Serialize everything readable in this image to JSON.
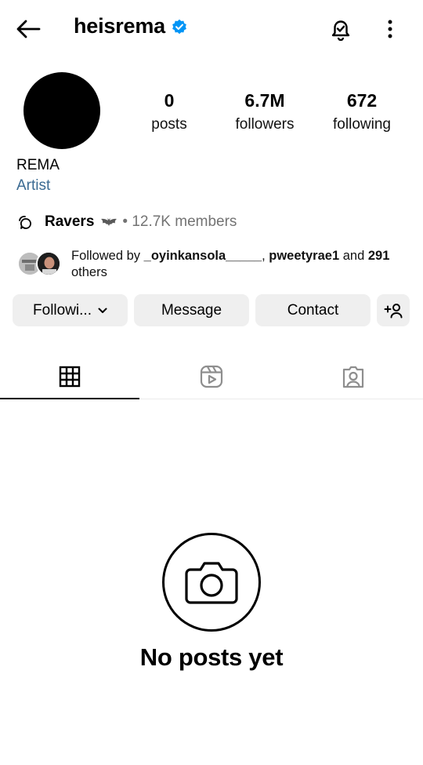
{
  "header": {
    "username": "heisrema",
    "verified_color": "#0095f6",
    "icons": {
      "back": "arrow-left-icon",
      "notifications": "bell-check-icon",
      "more": "more-vertical-icon"
    }
  },
  "profile": {
    "stats": {
      "posts_value": "0",
      "posts_label": "posts",
      "followers_value": "6.7M",
      "followers_label": "followers",
      "following_value": "672",
      "following_label": "following"
    },
    "name": "REMA",
    "category": "Artist",
    "category_color": "#3b6a92"
  },
  "community": {
    "name": "Ravers",
    "members": "• 12.7K members"
  },
  "followed_by": {
    "prefix": "Followed by ",
    "user1": "_oyinkansola_____",
    "separator": ", ",
    "user2": "pweetyrae1",
    "middle": " and ",
    "count": "291",
    "suffix": " others"
  },
  "actions": {
    "following_label": "Followi...",
    "message_label": "Message",
    "contact_label": "Contact"
  },
  "tabs": [
    "grid-icon",
    "reels-icon",
    "tagged-icon"
  ],
  "empty_state": {
    "title": "No posts yet",
    "icon": "camera-icon"
  }
}
